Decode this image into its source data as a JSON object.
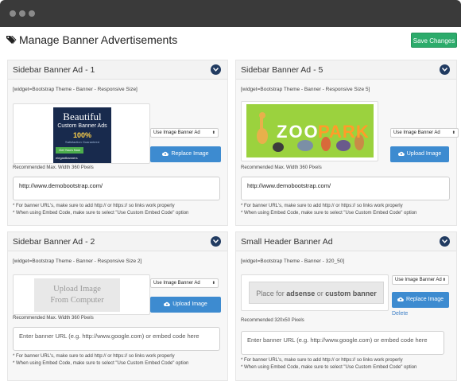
{
  "header": {
    "title": "Manage Banner Advertisements",
    "save_label": "Save Changes"
  },
  "cards": [
    {
      "title": "Sidebar Banner Ad - 1",
      "widget": "[widget=Bootstrap Theme - Banner - Responsive Size]",
      "select": "Use Image Banner Ad",
      "button": "Replace Image",
      "recommended": "Recommended Max. Width 360 Pixels",
      "url": "http://www.demobootstrap.com/",
      "note1": "* For banner URL's, make sure to add http:// or https:// so links work properly",
      "note2": "* When using Embed Code, make sure to select \"Use Custom Embed Code\" option",
      "banner": {
        "line1": "Beautiful",
        "line2": "Custom Banner Ads",
        "line3": "100%",
        "line4": "Satisfaction Guaranteed",
        "cta": "Get Yours Now",
        "brand": "elegantbanners"
      }
    },
    {
      "title": "Sidebar Banner Ad - 5",
      "widget": "[widget=Bootstrap Theme - Banner - Responsive Size 5]",
      "select": "Use Image Banner Ad",
      "button": "Upload Image",
      "recommended": "Recommended Max. Width 360 Pixels",
      "url": "http://www.demobootstrap.com/",
      "note1": "* For banner URL's, make sure to add http:// or https:// so links work properly",
      "note2": "* When using Embed Code, make sure to select \"Use Custom Embed Code\" option",
      "banner": {
        "zoo": "ZOO",
        "park": "PARK"
      }
    },
    {
      "title": "Sidebar Banner Ad - 2",
      "widget": "[widget=Bootstrap Theme - Banner - Responsive Size 2]",
      "select": "Use Image Banner Ad",
      "button": "Upload Image",
      "upload_text_1": "Upload Image",
      "upload_text_2": "From Computer",
      "recommended": "Recommended Max. Width 360 Pixels",
      "url_placeholder": "Enter banner URL (e.g. http://www.google.com) or embed code here",
      "note1": "* For banner URL's, make sure to add http:// or https:// so links work properly",
      "note2": "* When using Embed Code, make sure to select \"Use Custom Embed Code\" option"
    },
    {
      "title": "Small Header Banner Ad",
      "widget": "[widget=Bootstrap Theme - Banner - 320_50]",
      "select": "Use Image Banner Ad",
      "button": "Replace Image",
      "delete": "Delete",
      "placeholder_pre": "Place for ",
      "placeholder_b1": "adsense",
      "placeholder_mid": " or ",
      "placeholder_b2": "custom banner",
      "recommended": "Recommended 320x50 Pixels",
      "url_placeholder": "Enter banner URL (e.g. http://www.google.com) or embed code here",
      "note1": "* For banner URL's, make sure to add http:// or https:// so links work properly",
      "note2": "* When using Embed Code, make sure to select \"Use Custom Embed Code\" option"
    }
  ],
  "icons": {
    "tags": "tags-icon",
    "chevron": "chevron-down-icon",
    "cloud": "cloud-upload-icon"
  },
  "colors": {
    "save": "#2cab6b",
    "button": "#3d8bd0",
    "chevron": "#213b61",
    "link": "#3d7fc6"
  }
}
